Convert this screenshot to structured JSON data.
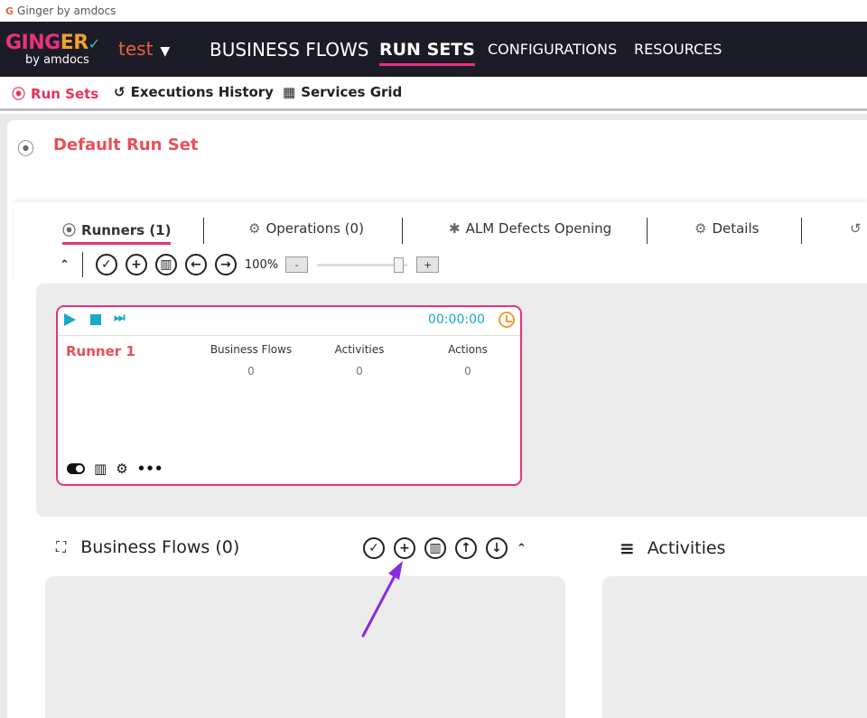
{
  "window": {
    "title": "Ginger by amdocs"
  },
  "topbar": {
    "logo_ginger_a": "GING",
    "logo_ginger_b": "ER",
    "logo_sub": "by amdocs",
    "solution": "test",
    "nav": {
      "business_flows": "BUSINESS FLOWS",
      "run_sets": "RUN SETS",
      "configurations": "CONFIGURATIONS",
      "resources": "RESOURCES"
    }
  },
  "subnav": {
    "run_sets": "Run Sets",
    "executions_history": "Executions History",
    "services_grid": "Services Grid"
  },
  "runset": {
    "title": "Default Run Set"
  },
  "tabs": {
    "runners": "Runners (1)",
    "operations": "Operations (0)",
    "alm": "ALM Defects Opening",
    "details": "Details"
  },
  "toolbar": {
    "zoom": "100%",
    "zoom_minus": "-",
    "zoom_plus": "+",
    "zoom_level": 0.9
  },
  "runner": {
    "name": "Runner 1",
    "time": "00:00:00",
    "columns": [
      {
        "label": "Business Flows",
        "value": "0"
      },
      {
        "label": "Activities",
        "value": "0"
      },
      {
        "label": "Actions",
        "value": "0"
      }
    ]
  },
  "business_flows": {
    "title": "Business Flows (0)"
  },
  "activities": {
    "title": "Activities"
  },
  "colors": {
    "accent": "#e8327a",
    "title_red": "#e8505a",
    "runner_blue": "#19a8c8",
    "arrow": "#8a2be2"
  }
}
